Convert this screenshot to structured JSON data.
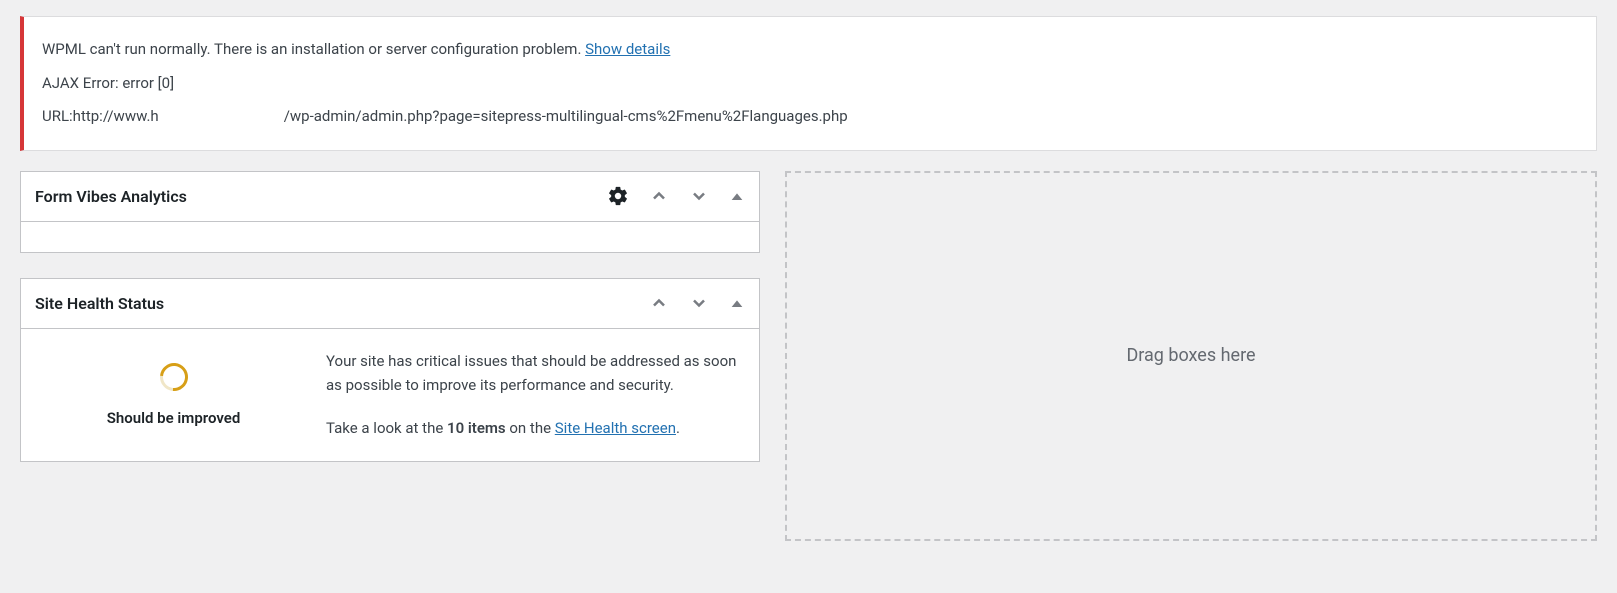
{
  "notice": {
    "line1_prefix": "WPML can't run normally. There is an installation or server configuration problem. ",
    "show_details_link": "Show details",
    "line2": "AJAX Error: error [0]",
    "line3_prefix": "URL:http://www.h",
    "line3_suffix": "/wp-admin/admin.php?page=sitepress-multilingual-cms%2Fmenu%2Flanguages.php"
  },
  "widgets": {
    "form_vibes": {
      "title": "Form Vibes Analytics"
    },
    "site_health": {
      "title": "Site Health Status",
      "status_label": "Should be improved",
      "body_p1": "Your site has critical issues that should be addressed as soon as possible to improve its performance and security.",
      "body_p2_pre": "Take a look at the ",
      "body_p2_strong": "10 items",
      "body_p2_mid": " on the ",
      "body_p2_link": "Site Health screen",
      "body_p2_post": "."
    }
  },
  "dropzone": {
    "text": "Drag boxes here"
  }
}
